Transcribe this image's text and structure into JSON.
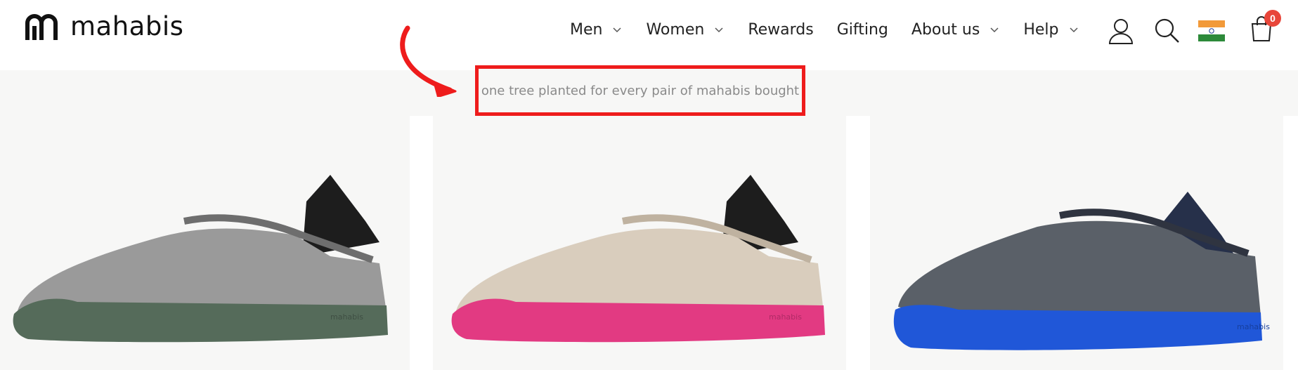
{
  "brand": {
    "name": "mahabis"
  },
  "nav": {
    "items": [
      {
        "label": "Men",
        "has_dropdown": true
      },
      {
        "label": "Women",
        "has_dropdown": true
      },
      {
        "label": "Rewards",
        "has_dropdown": false
      },
      {
        "label": "Gifting",
        "has_dropdown": false
      },
      {
        "label": "About us",
        "has_dropdown": true
      },
      {
        "label": "Help",
        "has_dropdown": true
      }
    ]
  },
  "header_icons": {
    "account": "user-icon",
    "search": "search-icon",
    "region": "india-flag-icon",
    "cart": "shopping-bag-icon",
    "cart_count": "0"
  },
  "banner": {
    "text": "one tree planted for every pair of mahabis bought"
  },
  "annotation": {
    "arrow_color": "#ee1c1c",
    "box_color": "#ee1c1c"
  },
  "products": [
    {
      "image": "grey-slipper-green-sole",
      "upper_color": "#9a9a9a",
      "sole_color": "#556b5a",
      "sole_print": "mahabis"
    },
    {
      "image": "beige-slipper-pink-sole",
      "upper_color": "#d9cdbd",
      "sole_color": "#e23a82",
      "sole_print": "mahabis"
    },
    {
      "image": "dark-grey-slipper-blue-sole",
      "upper_color": "#5a6068",
      "sole_color": "#2057d8",
      "sole_print": "mahabis"
    }
  ]
}
